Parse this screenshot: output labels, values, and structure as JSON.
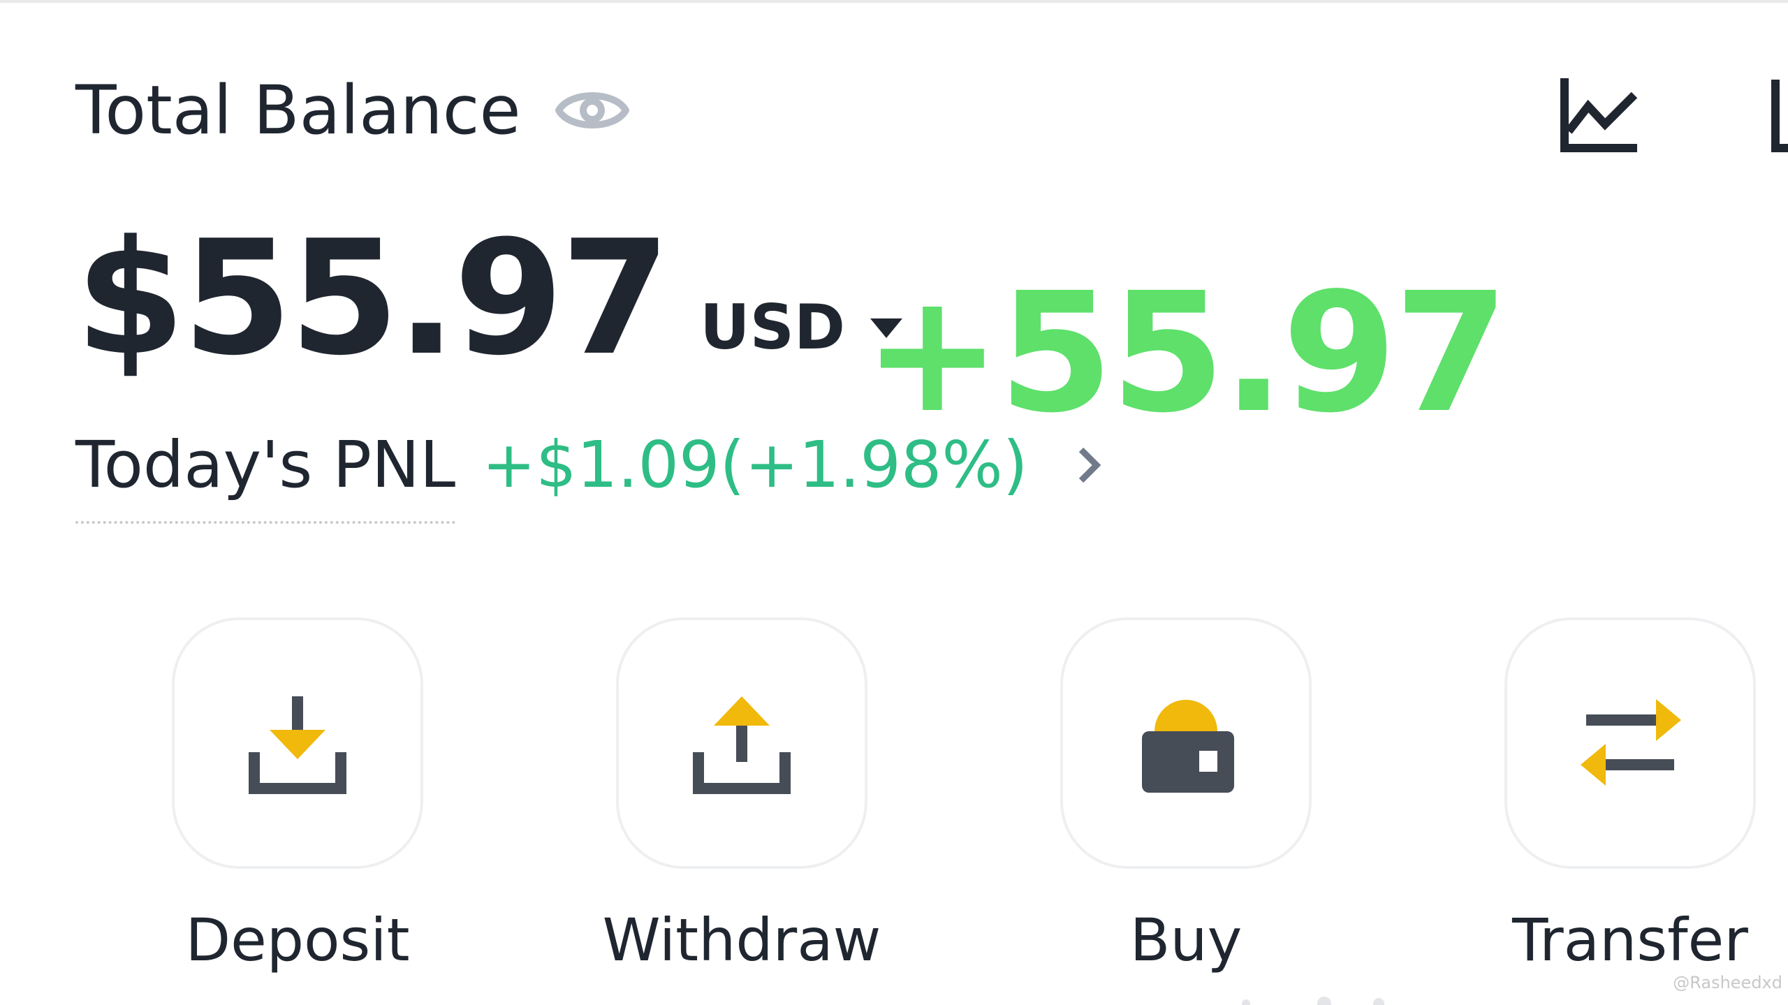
{
  "header": {
    "title": "Total Balance",
    "visibility_icon": "eye-icon",
    "right_icons": [
      "chart-icon",
      "history-icon"
    ]
  },
  "balance": {
    "amount": "$55.97",
    "currency": "USD",
    "currency_icon": "caret-down-icon"
  },
  "overlay": {
    "text": "+55.97",
    "color": "#5ee06b"
  },
  "pnl": {
    "label": "Today's PNL",
    "value": "+$1.09(+1.98%)",
    "value_color": "#2ebd85",
    "icon": "chevron-right-icon"
  },
  "actions": [
    {
      "label": "Deposit",
      "icon": "deposit-icon"
    },
    {
      "label": "Withdraw",
      "icon": "withdraw-icon"
    },
    {
      "label": "Buy",
      "icon": "buy-icon"
    },
    {
      "label": "Transfer",
      "icon": "transfer-icon"
    }
  ],
  "colors": {
    "text_primary": "#202630",
    "accent_yellow": "#f0b90b",
    "icon_dark": "#474d57",
    "positive": "#2ebd85"
  },
  "watermark": "@Rasheedxd"
}
